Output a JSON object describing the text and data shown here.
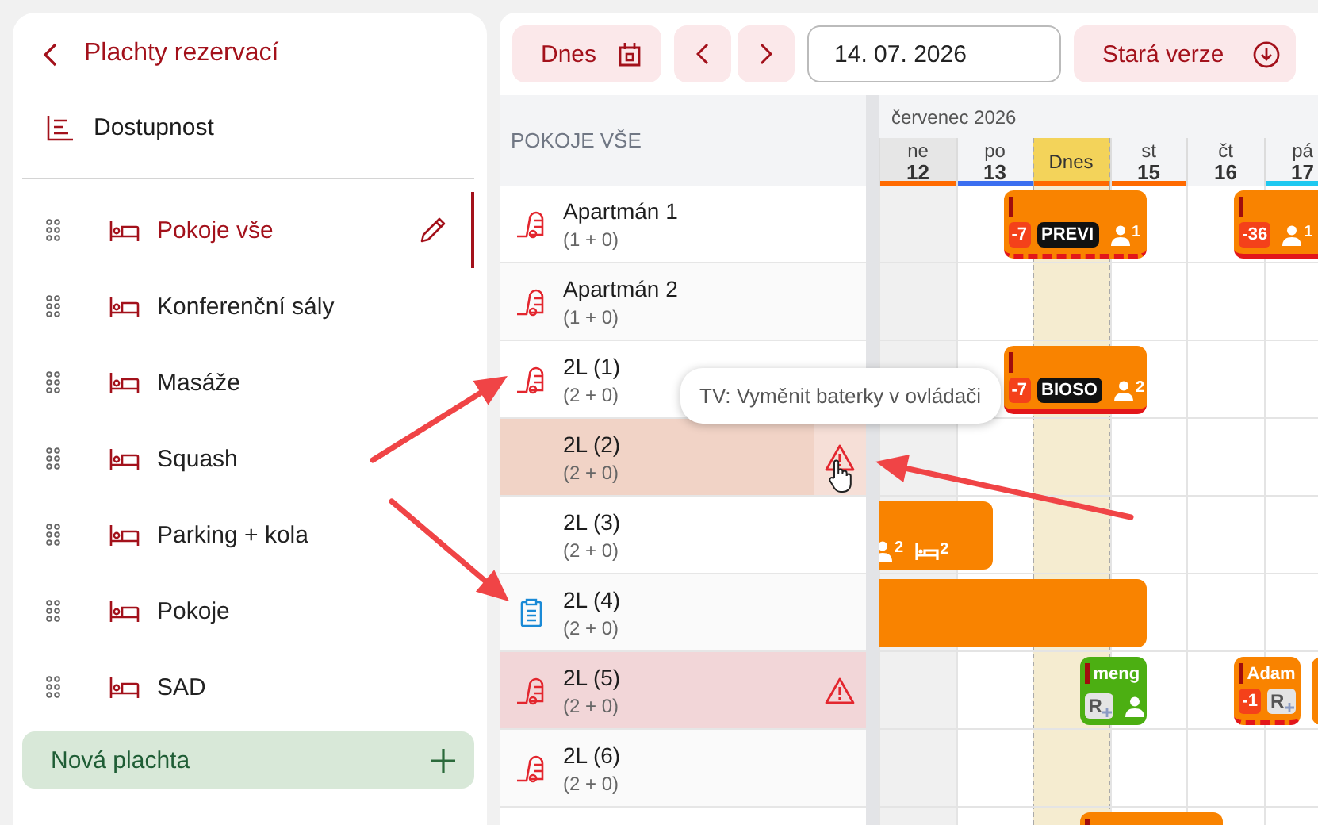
{
  "sidebar": {
    "title": "Plachty rezervací",
    "availability": "Dostupnost",
    "items": [
      {
        "label": "Pokoje vše",
        "selected": true
      },
      {
        "label": "Konferenční sály",
        "selected": false
      },
      {
        "label": "Masáže",
        "selected": false
      },
      {
        "label": "Squash",
        "selected": false
      },
      {
        "label": "Parking + kola",
        "selected": false
      },
      {
        "label": "Pokoje",
        "selected": false
      },
      {
        "label": "SAD",
        "selected": false
      }
    ],
    "new_button": "Nová plachta"
  },
  "toolbar": {
    "today_button": "Dnes",
    "date_field": "14. 07. 2026",
    "old_version_button": "Stará verze"
  },
  "grid": {
    "rooms_heading": "POKOJE VŠE",
    "month": "červenec 2026",
    "days": [
      {
        "weekday": "ne",
        "number": "12",
        "today": false,
        "weekend": true,
        "color": "#ff6a00"
      },
      {
        "weekday": "po",
        "number": "13",
        "today": false,
        "weekend": false,
        "color": "#3b6ff0"
      },
      {
        "weekday": "Dnes",
        "today": true,
        "weekend": false,
        "color": "#ff6a00"
      },
      {
        "weekday": "st",
        "number": "15",
        "today": false,
        "weekend": false,
        "color": "#ff6a00"
      },
      {
        "weekday": "čt",
        "number": "16",
        "today": false,
        "weekend": false
      },
      {
        "weekday": "pá",
        "number": "17",
        "today": false,
        "weekend": false,
        "color": "#1ec8f0"
      }
    ],
    "rooms": [
      {
        "kind": "cleaning",
        "name": "Apartmán 1",
        "capacity": "(1 + 0)",
        "warning": false,
        "hovered": false,
        "bookings": [
          {
            "color": "#f98300",
            "marker": true,
            "badges": [
              {
                "kind": "discount",
                "text": "-7"
              },
              {
                "kind": "tag",
                "text": "PREVI"
              },
              {
                "kind": "guests",
                "count": "1"
              }
            ]
          },
          {
            "color": "#f98300",
            "marker": true,
            "badges": [
              {
                "kind": "discount",
                "text": "-36"
              },
              {
                "kind": "guests",
                "count": "1"
              }
            ]
          }
        ]
      },
      {
        "kind": "cleaning",
        "name": "Apartmán 2",
        "capacity": "(1 + 0)",
        "warning": false,
        "hovered": false
      },
      {
        "kind": "cleaning",
        "name": "2L (1)",
        "capacity": "(2 + 0)",
        "warning": false,
        "hovered": false,
        "bookings": [
          {
            "color": "#f98300",
            "marker": true,
            "badges": [
              {
                "kind": "discount",
                "text": "-7"
              },
              {
                "kind": "tag",
                "text": "BIOSO"
              },
              {
                "kind": "guests",
                "count": "2"
              }
            ]
          }
        ]
      },
      {
        "kind": "plain",
        "name": "2L (2)",
        "capacity": "(2 + 0)",
        "warning": true,
        "hovered": true,
        "tooltip": "TV: Vyměnit baterky v ovládači"
      },
      {
        "kind": "plain",
        "name": "2L (3)",
        "capacity": "(2 + 0)",
        "warning": false,
        "hovered": false,
        "bookings": [
          {
            "color": "#f98300",
            "marker": false,
            "badges": [
              {
                "kind": "guests",
                "count": "2"
              },
              {
                "kind": "beds",
                "count": "2"
              }
            ]
          }
        ]
      },
      {
        "kind": "checklist",
        "name": "2L (4)",
        "capacity": "(2 + 0)",
        "warning": false,
        "hovered": false,
        "bookings": [
          {
            "color": "#f98300",
            "marker": false
          }
        ]
      },
      {
        "kind": "cleaning",
        "name": "2L (5)",
        "capacity": "(2 + 0)",
        "warning": true,
        "hovered": false,
        "bookings": [
          {
            "color": "#4caf12",
            "marker": true,
            "name": "meng",
            "badges": [
              {
                "kind": "rplus",
                "text": "R"
              },
              {
                "kind": "guests"
              }
            ]
          },
          {
            "color": "#f98300",
            "marker": true,
            "name": "Adam",
            "badges": [
              {
                "kind": "discount",
                "text": "-1"
              },
              {
                "kind": "rplus",
                "text": "R"
              }
            ]
          },
          {
            "color": "#f98300",
            "marker": false
          }
        ]
      },
      {
        "kind": "cleaning",
        "name": "2L (6)",
        "capacity": "(2 + 0)",
        "warning": false,
        "hovered": false
      },
      {
        "kind": "plain",
        "bookings": [
          {
            "color": "#f98300",
            "marker": true
          }
        ]
      }
    ]
  }
}
